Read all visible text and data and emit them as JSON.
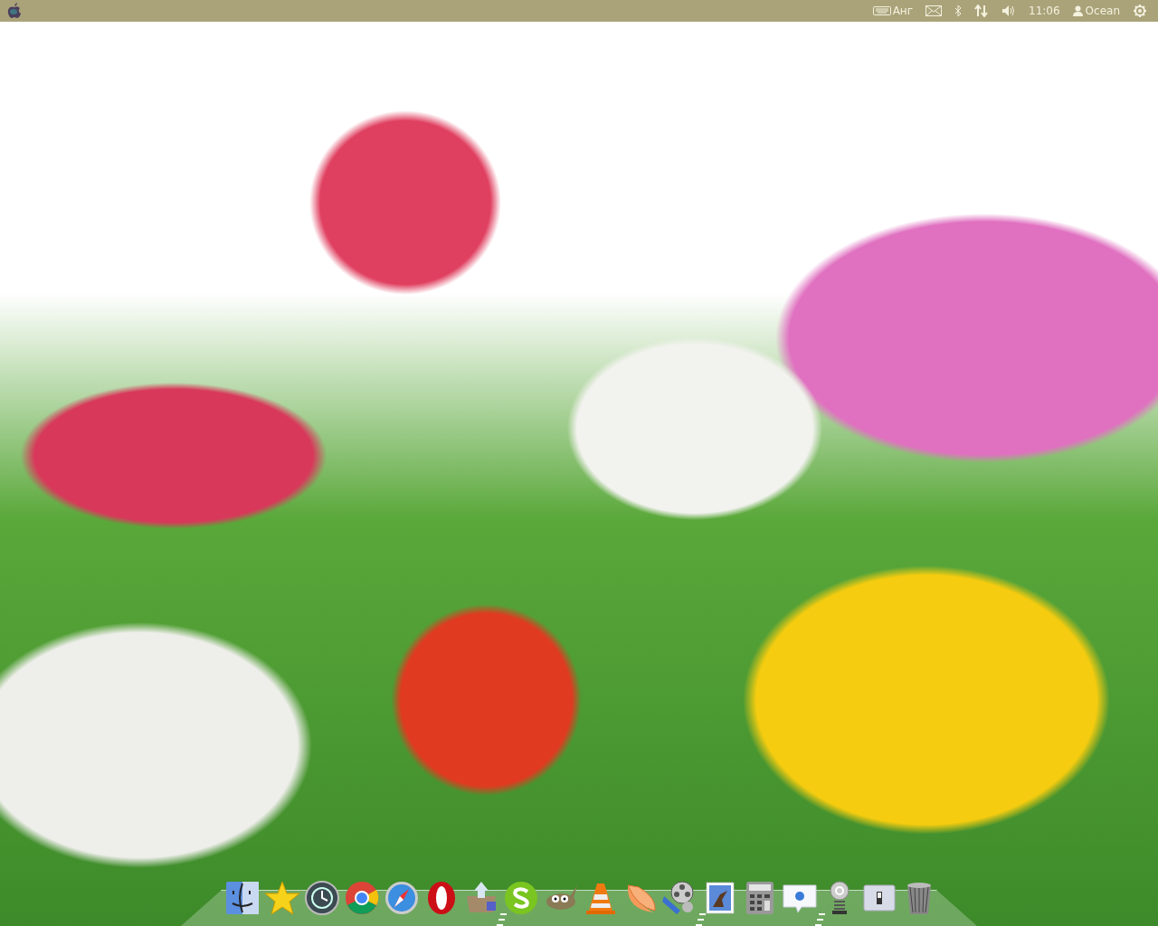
{
  "menu_bar": {
    "keyboard_layout": "Анг",
    "clock": "11:06",
    "user": "Ocean"
  },
  "wallpaper": {
    "kind": "photo"
  },
  "dock": {
    "items": [
      {
        "kind": "finder",
        "running": false
      },
      {
        "kind": "star",
        "running": false
      },
      {
        "kind": "clock",
        "running": false
      },
      {
        "kind": "chrome",
        "running": false
      },
      {
        "kind": "compass",
        "running": false
      },
      {
        "kind": "opera",
        "running": false
      },
      {
        "kind": "box",
        "running": true
      },
      {
        "kind": "skype",
        "running": false
      },
      {
        "kind": "gimp",
        "running": false
      },
      {
        "kind": "cone",
        "running": false
      },
      {
        "kind": "orange",
        "running": false
      },
      {
        "kind": "film",
        "running": true
      },
      {
        "kind": "stamp",
        "running": false
      },
      {
        "kind": "calculator",
        "running": false
      },
      {
        "kind": "chat",
        "running": true
      },
      {
        "kind": "at",
        "running": false
      },
      {
        "kind": "switch",
        "running": false
      },
      {
        "kind": "trash",
        "running": false
      }
    ]
  }
}
